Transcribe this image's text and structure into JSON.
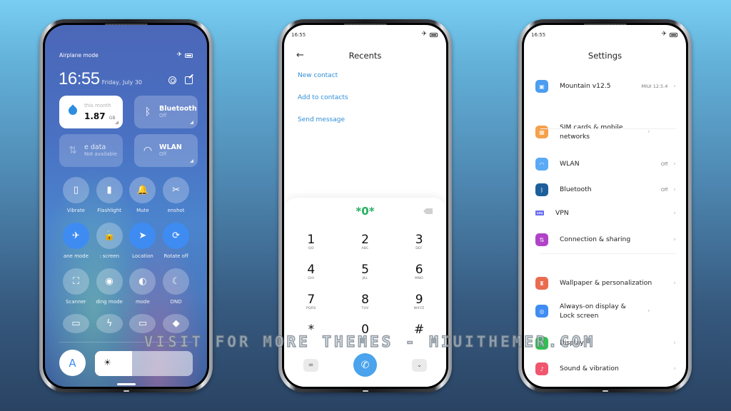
{
  "control_center": {
    "status_label": "Airplane mode",
    "time": "16:55",
    "date": "Friday, July 30",
    "tiles": [
      {
        "title": "this month",
        "value": "1.87",
        "unit": "GB",
        "icon": "water-drop-icon"
      },
      {
        "title": "Bluetooth",
        "sub": "Off",
        "icon": "bluetooth-icon"
      },
      {
        "title": "e data",
        "sub": "Not available",
        "icon": "mobile-data-icon"
      },
      {
        "title": "WLAN",
        "sub": "Off",
        "icon": "wifi-icon"
      }
    ],
    "toggles": [
      {
        "label": "Vibrate",
        "icon": "vibrate-icon",
        "glyph": "▯",
        "on": false
      },
      {
        "label": "Flashlight",
        "icon": "flashlight-icon",
        "glyph": "▮",
        "on": false
      },
      {
        "label": "Mute",
        "icon": "bell-icon",
        "glyph": "🔔",
        "on": false
      },
      {
        "label": "enshot",
        "icon": "screenshot-icon",
        "glyph": "✂",
        "on": false
      },
      {
        "label": "ane mode",
        "icon": "airplane-icon",
        "glyph": "✈",
        "on": true
      },
      {
        "label": ": screen",
        "icon": "lock-icon",
        "glyph": "🔒",
        "on": false
      },
      {
        "label": "Location",
        "icon": "location-arrow-icon",
        "glyph": "➤",
        "on": true
      },
      {
        "label": "Rotate off",
        "icon": "rotate-lock-icon",
        "glyph": "⟳",
        "on": true
      },
      {
        "label": "Scanner",
        "icon": "scanner-icon",
        "glyph": "⛶",
        "on": false
      },
      {
        "label": "ding mode",
        "icon": "eye-icon",
        "glyph": "◉",
        "on": false
      },
      {
        "label": "mode",
        "icon": "dark-mode-icon",
        "glyph": "◐",
        "on": false
      },
      {
        "label": "DND",
        "icon": "moon-icon",
        "glyph": "☾",
        "on": false
      },
      {
        "label": "",
        "icon": "battery-saver-icon",
        "glyph": "▭",
        "on": false
      },
      {
        "label": "",
        "icon": "lightning-icon",
        "glyph": "ϟ",
        "on": false
      },
      {
        "label": "",
        "icon": "cast-screen-icon",
        "glyph": "▭",
        "on": false
      },
      {
        "label": "",
        "icon": "diamond-icon",
        "glyph": "◆",
        "on": false
      }
    ],
    "auto_brightness_label": "A",
    "brightness_level": 0.38
  },
  "dialer": {
    "status_time": "16:55",
    "title": "Recents",
    "links": [
      "New contact",
      "Add to contacts",
      "Send message"
    ],
    "entered_number": "*0*",
    "keys": [
      {
        "d": "1",
        "l": "QO"
      },
      {
        "d": "2",
        "l": "ABC"
      },
      {
        "d": "3",
        "l": "DEF"
      },
      {
        "d": "4",
        "l": "GHI"
      },
      {
        "d": "5",
        "l": "JKL"
      },
      {
        "d": "6",
        "l": "MNO"
      },
      {
        "d": "7",
        "l": "PQRS"
      },
      {
        "d": "8",
        "l": "TUV"
      },
      {
        "d": "9",
        "l": "WXYZ"
      },
      {
        "d": "*",
        "l": ""
      },
      {
        "d": "0",
        "l": "+"
      },
      {
        "d": "#",
        "l": ""
      }
    ]
  },
  "settings": {
    "status_time": "16:55",
    "title": "Settings",
    "items": [
      {
        "label": "Mountain v12.5",
        "value": "MIUI 12.5.4",
        "icon": "phone-info-icon",
        "color": "#4a9df0"
      },
      {
        "label": "SIM cards & mobile networks",
        "value": "",
        "icon": "sim-card-icon",
        "color": "#f5a04a"
      },
      {
        "label": "WLAN",
        "value": "Off",
        "icon": "wifi-icon",
        "color": "#5aaaf5"
      },
      {
        "label": "Bluetooth",
        "value": "Off",
        "icon": "bluetooth-icon",
        "color": "#1d5f9b"
      },
      {
        "label": "VPN",
        "value": "",
        "icon": "vpn-icon",
        "color": "#6a6ff0"
      },
      {
        "label": "Connection & sharing",
        "value": "",
        "icon": "connection-sharing-icon",
        "color": "#b043c8"
      },
      {
        "label": "Wallpaper & personalization",
        "value": "",
        "icon": "wallpaper-icon",
        "color": "#ea6b4f"
      },
      {
        "label": "Always-on display & Lock screen",
        "value": "",
        "icon": "lock-screen-icon",
        "color": "#3f8cf2"
      },
      {
        "label": "Display",
        "value": "",
        "icon": "display-icon",
        "color": "#2fc24f"
      },
      {
        "label": "Sound & vibration",
        "value": "",
        "icon": "sound-icon",
        "color": "#f0566e"
      }
    ]
  },
  "watermark": "VISIT FOR MORE THEMES - MIUITHEMER.COM"
}
